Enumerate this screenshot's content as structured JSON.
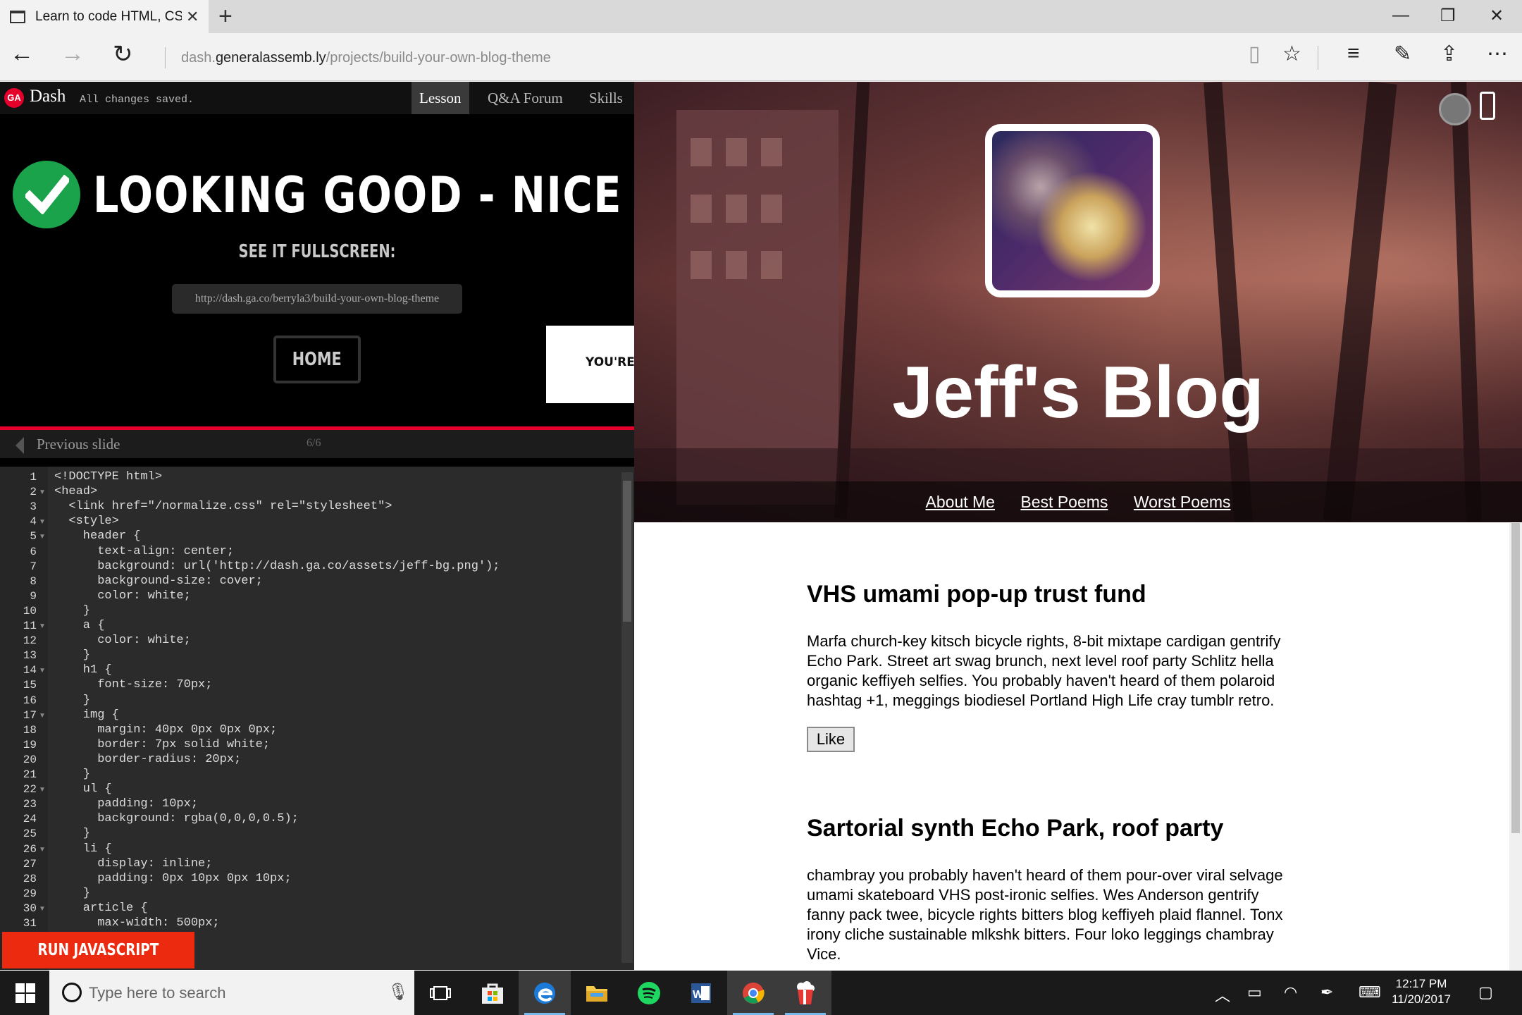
{
  "browser": {
    "tab_title": "Learn to code HTML, CS",
    "new_tab": "+",
    "window_controls": {
      "minimize": "—",
      "restore": "❐",
      "close": "✕"
    },
    "address_prefix": "dash.",
    "address_host": "generalassemb.ly",
    "address_path": "/projects/build-your-own-blog-theme"
  },
  "dash": {
    "logo": "GA",
    "brand": "Dash",
    "status": "All changes saved.",
    "tabs": [
      "Lesson",
      "Q&A Forum",
      "Skills"
    ],
    "headline": "LOOKING GOOD - NICE WORK!",
    "fullscreen_label": "SEE IT FULLSCREEN:",
    "fullscreen_url": "http://dash.ga.co/berryla3/build-your-own-blog-theme",
    "home_button": "HOME",
    "next_box_text": "YOU'RE D",
    "previous_slide": "Previous slide",
    "slide_counter": "6/6",
    "run_button": "RUN JAVASCRIPT",
    "line_numbers": [
      "1",
      "2",
      "3",
      "4",
      "5",
      "6",
      "7",
      "8",
      "9",
      "10",
      "11",
      "12",
      "13",
      "14",
      "15",
      "16",
      "17",
      "18",
      "19",
      "20",
      "21",
      "22",
      "23",
      "24",
      "25",
      "26",
      "27",
      "28",
      "29",
      "30",
      "31"
    ],
    "code_lines": [
      "<!DOCTYPE html>",
      "<head>",
      "  <link href=\"/normalize.css\" rel=\"stylesheet\">",
      "  <style>",
      "    header {",
      "      text-align: center;",
      "      background: url('http://dash.ga.co/assets/jeff-bg.png');",
      "      background-size: cover;",
      "      color: white;",
      "    }",
      "    a {",
      "      color: white;",
      "    }",
      "    h1 {",
      "      font-size: 70px;",
      "    }",
      "    img {",
      "      margin: 40px 0px 0px 0px;",
      "      border: 7px solid white;",
      "      border-radius: 20px;",
      "    }",
      "    ul {",
      "      padding: 10px;",
      "      background: rgba(0,0,0,0.5);",
      "    }",
      "    li {",
      "      display: inline;",
      "      padding: 0px 10px 0px 10px;",
      "    }",
      "    article {",
      "      max-width: 500px;"
    ]
  },
  "preview": {
    "blog_title": "Jeff's Blog",
    "nav_links": [
      "About Me",
      "Best Poems",
      "Worst Poems"
    ],
    "articles": [
      {
        "title": "VHS umami pop-up trust fund",
        "body": [
          "Marfa church-key kitsch bicycle rights, 8-bit mixtape cardigan gentrify",
          "Echo Park. Street art swag brunch, next level roof party Schlitz hella",
          "organic keffiyeh selfies. You probably haven't heard of them polaroid",
          "hashtag +1, meggings biodiesel Portland High Life cray tumblr retro."
        ]
      },
      {
        "title": "Sartorial synth Echo Park, roof party",
        "body": [
          "chambray you probably haven't heard of them pour-over viral selvage",
          "umami skateboard VHS post-ironic selfies. Wes Anderson gentrify",
          "fanny pack twee, bicycle rights bitters blog keffiyeh plaid flannel. Tonx",
          "irony cliche sustainable mlkshk bitters. Four loko leggings chambray",
          "Vice."
        ]
      }
    ],
    "like_button": "Like"
  },
  "taskbar": {
    "search_placeholder": "Type here to search",
    "time": "12:17 PM",
    "date": "11/20/2017",
    "apps": [
      "task-view",
      "store",
      "edge",
      "file-explorer",
      "spotify",
      "word",
      "chrome",
      "popcorn"
    ]
  },
  "colors": {
    "ga_red": "#e4002b",
    "check_green": "#1aa34a",
    "run_button": "#ec2a0f",
    "taskbar": "#1a1a1a"
  }
}
